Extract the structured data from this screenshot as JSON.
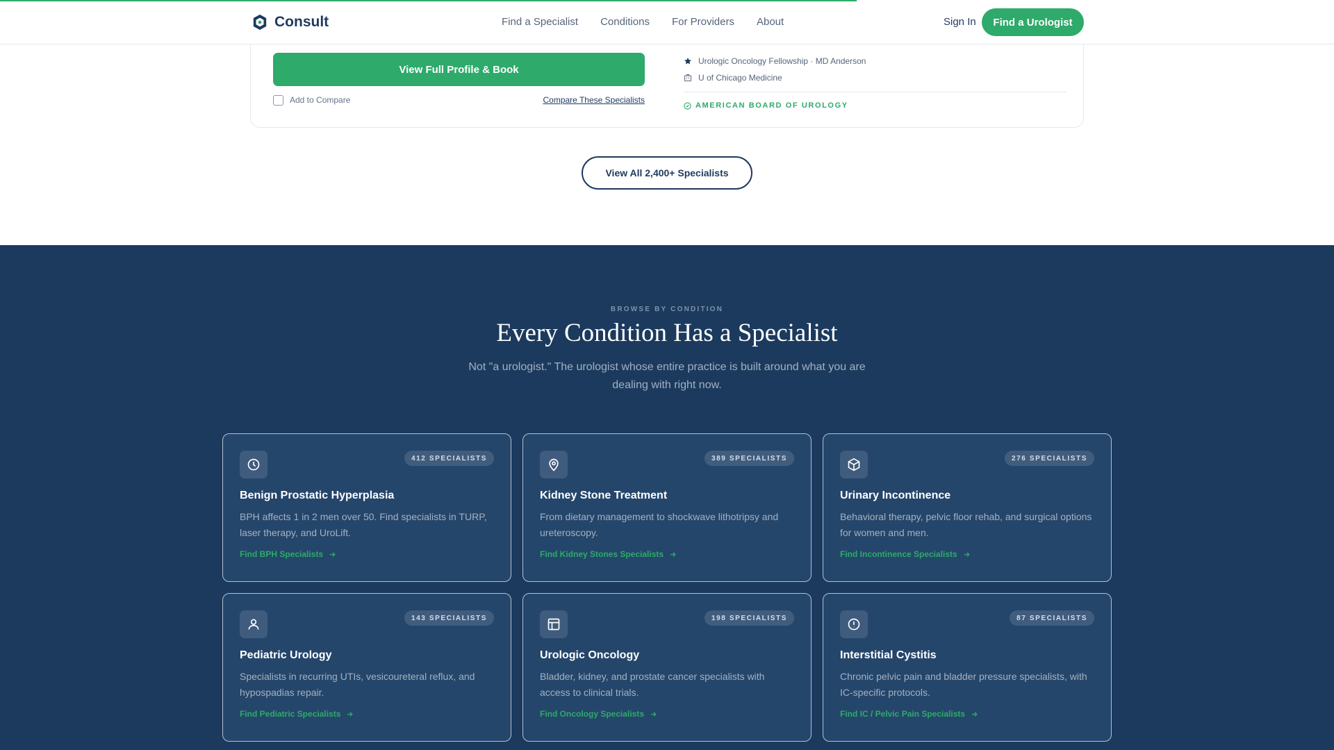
{
  "header": {
    "logo_text": "Consult",
    "nav": [
      "Find a Specialist",
      "Conditions",
      "For Providers",
      "About"
    ],
    "sign_in": "Sign In",
    "cta": "Find a Urologist",
    "accent": "#2eaa6a"
  },
  "profile_card": {
    "book_label": "View Full Profile & Book",
    "add_compare": "Add to Compare",
    "compare_link": "Compare These Specialists",
    "fellowship": "Urologic Oncology Fellowship · MD Anderson",
    "hospital": "U of Chicago Medicine",
    "board": "AMERICAN BOARD OF UROLOGY"
  },
  "view_all_label": "View All 2,400+ Specialists",
  "conditions": {
    "eyebrow": "BROWSE BY CONDITION",
    "title": "Every Condition Has a Specialist",
    "subtitle": "Not \"a urologist.\" The urologist whose entire practice is built around what you are dealing with right now.",
    "cards": [
      {
        "icon": "clock-icon",
        "badge": "412 SPECIALISTS",
        "title": "Benign Prostatic Hyperplasia",
        "desc": "BPH affects 1 in 2 men over 50. Find specialists in TURP, laser therapy, and UroLift.",
        "link": "Find BPH Specialists"
      },
      {
        "icon": "location-pin-icon",
        "badge": "389 SPECIALISTS",
        "title": "Kidney Stone Treatment",
        "desc": "From dietary management to shockwave lithotripsy and ureteroscopy.",
        "link": "Find Kidney Stones Specialists"
      },
      {
        "icon": "cube-icon",
        "badge": "276 SPECIALISTS",
        "title": "Urinary Incontinence",
        "desc": "Behavioral therapy, pelvic floor rehab, and surgical options for women and men.",
        "link": "Find Incontinence Specialists"
      },
      {
        "icon": "person-icon",
        "badge": "143 SPECIALISTS",
        "title": "Pediatric Urology",
        "desc": "Specialists in recurring UTIs, vesicoureteral reflux, and hypospadias repair.",
        "link": "Find Pediatric Specialists"
      },
      {
        "icon": "layout-icon",
        "badge": "198 SPECIALISTS",
        "title": "Urologic Oncology",
        "desc": "Bladder, kidney, and prostate cancer specialists with access to clinical trials.",
        "link": "Find Oncology Specialists"
      },
      {
        "icon": "alert-circle-icon",
        "badge": "87 SPECIALISTS",
        "title": "Interstitial Cystitis",
        "desc": "Chronic pelvic pain and bladder pressure specialists, with IC-specific protocols.",
        "link": "Find IC / Pelvic Pain Specialists"
      }
    ]
  }
}
